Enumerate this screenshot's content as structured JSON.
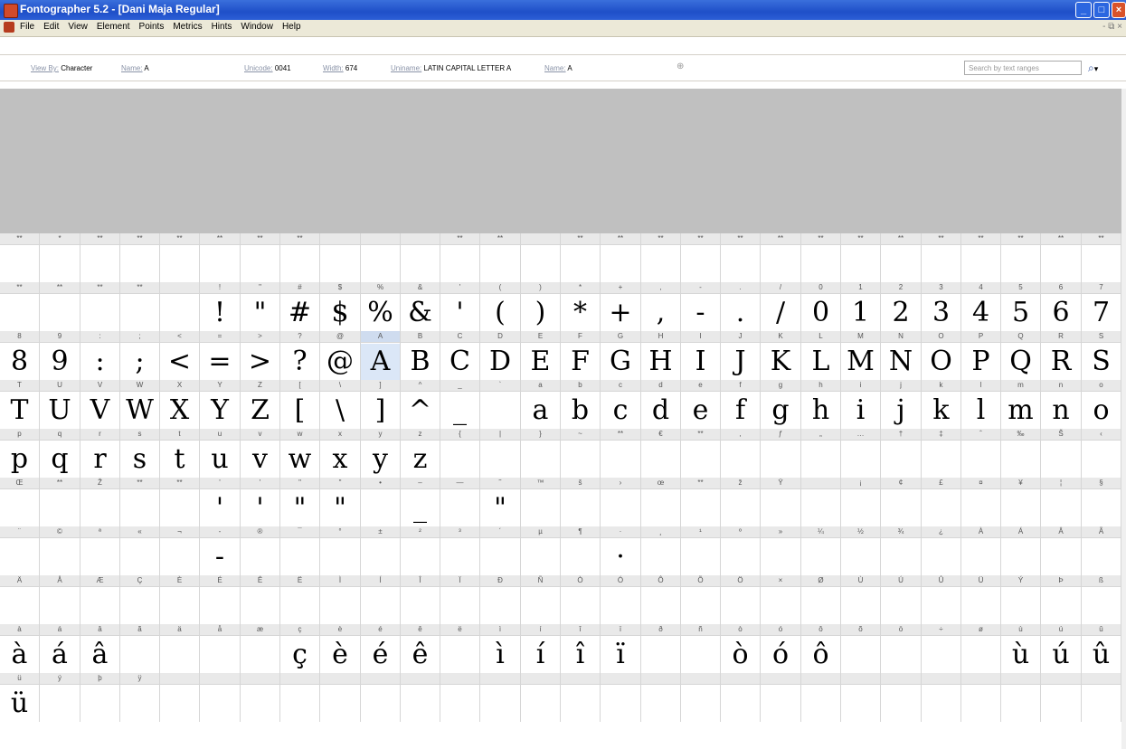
{
  "window": {
    "title": "Fontographer 5.2 - [Dani Maja Regular]",
    "controls": {
      "minimize": "_",
      "maximize": "□",
      "close": "×"
    }
  },
  "menubar": {
    "items": [
      "File",
      "Edit",
      "View",
      "Element",
      "Points",
      "Metrics",
      "Hints",
      "Window",
      "Help"
    ],
    "mdi_controls": "- ⧉ ×"
  },
  "infobar": {
    "view_by_label": "View By:",
    "view_by_value": "Character",
    "name_label": "Name:",
    "name_value": "A",
    "unicode_label": "Unicode:",
    "unicode_value": "0041",
    "width_label": "Width:",
    "width_value": "674",
    "uniname_label": "Uniname:",
    "uniname_value": "LATIN CAPITAL LETTER A",
    "name2_label": "Name:",
    "name2_value": "A",
    "search_placeholder": "Search by text ranges",
    "search_icon": "⌕",
    "search_dropdown": "▾"
  },
  "accent_color": "#dbe7f7",
  "selected_glyph": "A",
  "glyph_grid": {
    "columns": 28,
    "rows": [
      {
        "labels": [
          "**",
          "*",
          "**",
          "**",
          "**",
          "**",
          "**",
          "**",
          "",
          "",
          "",
          "**",
          "**",
          "",
          "**",
          "**",
          "**",
          "**",
          "**",
          "**",
          "**",
          "**",
          "**",
          "**",
          "**",
          "**",
          "**",
          "**"
        ],
        "glyphs": [
          "",
          "",
          "",
          "",
          "",
          "",
          "",
          "",
          "",
          "",
          "",
          "",
          "",
          "",
          "",
          "",
          "",
          "",
          "",
          "",
          "",
          "",
          "",
          "",
          "",
          "",
          "",
          ""
        ]
      },
      {
        "labels": [
          "**",
          "**",
          "**",
          "**",
          "",
          "!",
          "\"",
          "#",
          "$",
          "%",
          "&",
          "'",
          "(",
          ")",
          "*",
          "+",
          ",",
          "-",
          ".",
          "/",
          "0",
          "1",
          "2",
          "3",
          "4",
          "5",
          "6",
          "7"
        ],
        "glyphs": [
          "",
          "",
          "",
          "",
          "",
          "!",
          "\"",
          "#",
          "$",
          "%",
          "&",
          "'",
          "(",
          ")",
          "*",
          "+",
          ",",
          "-",
          ".",
          "/",
          "0",
          "1",
          "2",
          "3",
          "4",
          "5",
          "6",
          "7"
        ]
      },
      {
        "labels": [
          "8",
          "9",
          ":",
          ";",
          "<",
          "=",
          ">",
          "?",
          "@",
          "A",
          "B",
          "C",
          "D",
          "E",
          "F",
          "G",
          "H",
          "I",
          "J",
          "K",
          "L",
          "M",
          "N",
          "O",
          "P",
          "Q",
          "R",
          "S"
        ],
        "glyphs": [
          "8",
          "9",
          ":",
          ";",
          "<",
          "=",
          ">",
          "?",
          "@",
          "A",
          "B",
          "C",
          "D",
          "E",
          "F",
          "G",
          "H",
          "I",
          "J",
          "K",
          "L",
          "M",
          "N",
          "O",
          "P",
          "Q",
          "R",
          "S"
        ]
      },
      {
        "labels": [
          "T",
          "U",
          "V",
          "W",
          "X",
          "Y",
          "Z",
          "[",
          "\\",
          "]",
          "^",
          "_",
          "`",
          "a",
          "b",
          "c",
          "d",
          "e",
          "f",
          "g",
          "h",
          "i",
          "j",
          "k",
          "l",
          "m",
          "n",
          "o"
        ],
        "glyphs": [
          "T",
          "U",
          "V",
          "W",
          "X",
          "Y",
          "Z",
          "[",
          "\\",
          "]",
          "^",
          "_",
          "",
          "a",
          "b",
          "c",
          "d",
          "e",
          "f",
          "g",
          "h",
          "i",
          "j",
          "k",
          "l",
          "m",
          "n",
          "o"
        ]
      },
      {
        "labels": [
          "p",
          "q",
          "r",
          "s",
          "t",
          "u",
          "v",
          "w",
          "x",
          "y",
          "z",
          "{",
          "|",
          "}",
          "~",
          "**",
          "€",
          "**",
          ",",
          "ƒ",
          "„",
          "…",
          "†",
          "‡",
          "ˆ",
          "‰",
          "Š",
          "‹"
        ],
        "glyphs": [
          "p",
          "q",
          "r",
          "s",
          "t",
          "u",
          "v",
          "w",
          "x",
          "y",
          "z",
          "",
          "",
          "",
          "",
          "",
          "",
          "",
          "",
          "",
          "",
          "",
          "",
          "",
          "",
          "",
          "",
          ""
        ]
      },
      {
        "labels": [
          "Œ",
          "**",
          "Ž",
          "**",
          "**",
          "'",
          "'",
          "\"",
          "\"",
          "•",
          "–",
          "—",
          "˜",
          "™",
          "š",
          "›",
          "œ",
          "**",
          "ž",
          "Ÿ",
          "",
          "¡",
          "¢",
          "£",
          "¤",
          "¥",
          "¦",
          "§"
        ],
        "glyphs": [
          "",
          "",
          "",
          "",
          "",
          "'",
          "'",
          "\"",
          "\"",
          "",
          "_",
          "",
          "\"",
          "",
          "",
          "",
          "",
          "",
          "",
          "",
          "",
          "",
          "",
          "",
          "",
          "",
          "",
          ""
        ]
      },
      {
        "labels": [
          "¨",
          "©",
          "ª",
          "«",
          "¬",
          "-",
          "®",
          "¯",
          "°",
          "±",
          "²",
          "³",
          "´",
          "µ",
          "¶",
          "·",
          "¸",
          "¹",
          "º",
          "»",
          "¼",
          "½",
          "¾",
          "¿",
          "À",
          "Á",
          "Â",
          "Ã"
        ],
        "glyphs": [
          "",
          "",
          "",
          "",
          "",
          "-",
          "",
          "",
          "",
          "",
          "",
          "",
          "",
          "",
          "",
          "·",
          "",
          "",
          "",
          "",
          "",
          "",
          "",
          "",
          "",
          "",
          "",
          ""
        ]
      },
      {
        "labels": [
          "Ä",
          "Å",
          "Æ",
          "Ç",
          "È",
          "É",
          "Ê",
          "Ë",
          "Ì",
          "Í",
          "Î",
          "Ï",
          "Ð",
          "Ñ",
          "Ò",
          "Ó",
          "Ô",
          "Õ",
          "Ö",
          "×",
          "Ø",
          "Ù",
          "Ú",
          "Û",
          "Ü",
          "Ý",
          "Þ",
          "ß"
        ],
        "glyphs": [
          "",
          "",
          "",
          "",
          "",
          "",
          "",
          "",
          "",
          "",
          "",
          "",
          "",
          "",
          "",
          "",
          "",
          "",
          "",
          "",
          "",
          "",
          "",
          "",
          "",
          "",
          "",
          ""
        ]
      },
      {
        "labels": [
          "à",
          "á",
          "â",
          "ã",
          "ä",
          "å",
          "æ",
          "ç",
          "è",
          "é",
          "ê",
          "ë",
          "ì",
          "í",
          "î",
          "ï",
          "ð",
          "ñ",
          "ò",
          "ó",
          "ô",
          "õ",
          "ö",
          "÷",
          "ø",
          "ù",
          "ú",
          "û"
        ],
        "glyphs": [
          "à",
          "á",
          "â",
          "",
          "",
          "",
          "",
          "ç",
          "è",
          "é",
          "ê",
          "",
          "ì",
          "í",
          "î",
          "ï",
          "",
          "",
          "ò",
          "ó",
          "ô",
          "",
          "",
          "",
          "",
          "ù",
          "ú",
          "û"
        ]
      },
      {
        "labels": [
          "ü",
          "ý",
          "þ",
          "ÿ",
          "",
          "",
          "",
          "",
          "",
          "",
          "",
          "",
          "",
          "",
          "",
          "",
          "",
          "",
          "",
          "",
          "",
          "",
          "",
          "",
          "",
          "",
          "",
          ""
        ],
        "glyphs": [
          "ü",
          "",
          "",
          "",
          "",
          "",
          "",
          "",
          "",
          "",
          "",
          "",
          "",
          "",
          "",
          "",
          "",
          "",
          "",
          "",
          "",
          "",
          "",
          "",
          "",
          "",
          "",
          ""
        ]
      }
    ]
  }
}
